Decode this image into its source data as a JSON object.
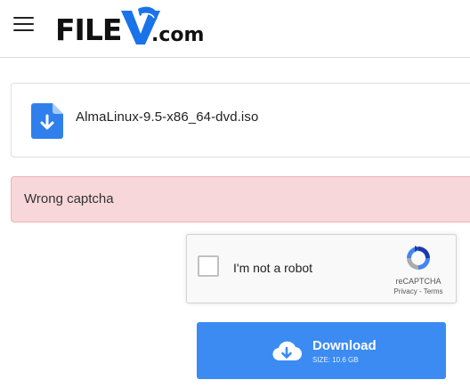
{
  "header": {
    "logo": {
      "part1": "FILE",
      "part2": ".com"
    }
  },
  "file": {
    "name": "AlmaLinux-9.5-x86_64-dvd.iso"
  },
  "alert": {
    "message": "Wrong captcha"
  },
  "captcha": {
    "label": "I'm not a robot",
    "brand": "reCAPTCHA",
    "privacy": "Privacy",
    "separator": " - ",
    "terms": "Terms"
  },
  "download": {
    "label": "Download",
    "size": "SIZE: 10.6 GB"
  },
  "colors": {
    "accent": "#3b8bf3",
    "alert_bg": "#f8d7da",
    "file_icon": "#2f80ed"
  },
  "icons": [
    "hamburger-menu-icon",
    "file-download-icon",
    "recaptcha-logo-icon",
    "cloud-download-icon"
  ]
}
